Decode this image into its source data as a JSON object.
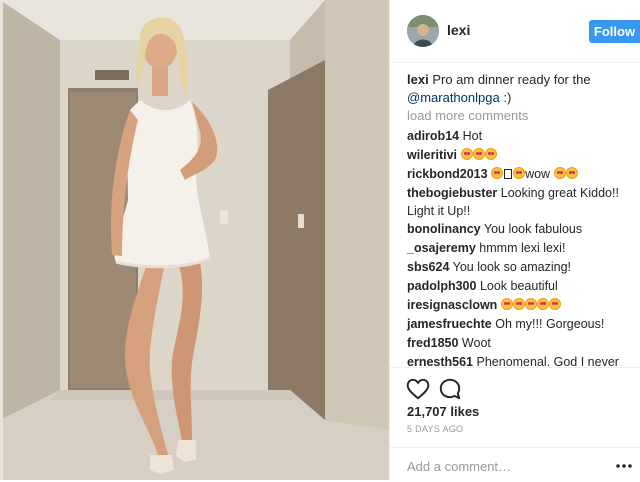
{
  "post": {
    "username": "lexi",
    "follow_label": "Follow",
    "caption": {
      "username": "lexi",
      "text": "Pro am dinner ready for the",
      "mention": "@marathonlpga",
      "suffix": ":)"
    },
    "load_more_label": "load more comments",
    "comments": [
      {
        "user": "adirob14",
        "text": "Hot",
        "emojis": 0
      },
      {
        "user": "wileritivi",
        "text": "",
        "emojis": 3
      },
      {
        "user": "rickbond2013",
        "text": "wow",
        "emojis_before": 1,
        "emojis": 2
      },
      {
        "user": "thebogiebuster",
        "text": "Looking great Kiddo!! Light it Up!!",
        "emojis": 0
      },
      {
        "user": "bonolinancy",
        "text": "You look fabulous",
        "emojis": 0
      },
      {
        "user": "_osajeremy",
        "text": "hmmm lexi lexi!",
        "emojis": 0
      },
      {
        "user": "sbs624",
        "text": "You look so amazing!",
        "emojis": 0
      },
      {
        "user": "padolph300",
        "text": "Look beautiful",
        "emojis": 0
      },
      {
        "user": "iresignasclown",
        "text": "",
        "emojis": 5
      },
      {
        "user": "jamesfruechte",
        "text": "Oh my!!! Gorgeous!",
        "emojis": 0
      },
      {
        "user": "fred1850",
        "text": "Woot",
        "emojis": 0
      },
      {
        "user": "ernesth561",
        "text": "Phenomenal. God I never had",
        "emojis": 0
      }
    ],
    "likes": "21,707 likes",
    "time": "5 DAYS AGO",
    "add_comment_placeholder": "Add a comment…"
  },
  "icons": {
    "like": "heart-icon",
    "comment": "comment-bubble-icon",
    "more": "more-options-icon"
  },
  "colors": {
    "follow_button": "#3897f0",
    "mention": "#003569",
    "muted": "#999999"
  }
}
